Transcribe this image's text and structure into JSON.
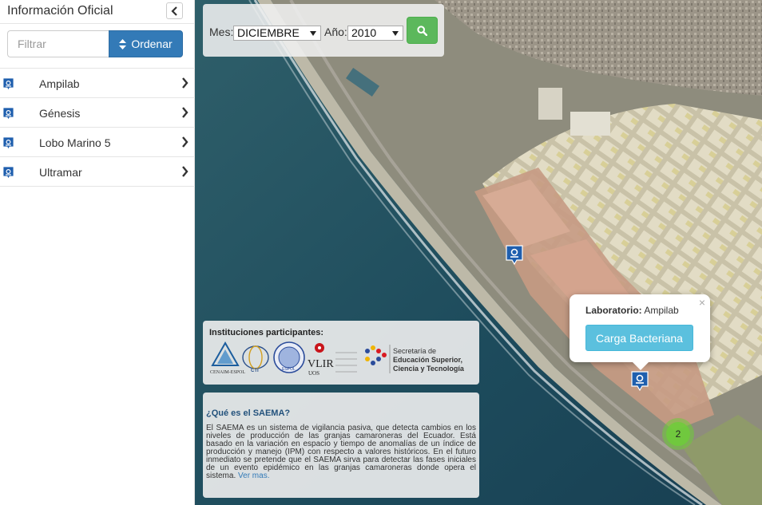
{
  "sidebar": {
    "title": "Información Oficial",
    "filter_placeholder": "Filtrar",
    "sort_label": "Ordenar",
    "items": [
      {
        "label": "Ampilab"
      },
      {
        "label": "Génesis"
      },
      {
        "label": "Lobo Marino 5"
      },
      {
        "label": "Ultramar"
      }
    ]
  },
  "filters": {
    "month_label": "Mes:",
    "month_value": "DICIEMBRE",
    "year_label": "Año:",
    "year_value": "2010"
  },
  "institutions": {
    "title": "Instituciones participantes:",
    "logos": {
      "cenaim": "CENAIM-ESPOL",
      "ctl": "CTI",
      "espol": "ESPOL",
      "vlir": "VLIR",
      "uos": "UOS",
      "senescyt_1": "Secretaría de",
      "senescyt_2": "Educación Superior,",
      "senescyt_3": "Ciencia y Tecnología"
    }
  },
  "about": {
    "title": "¿Qué es el SAEMA?",
    "text": "El SAEMA es un sistema de vigilancia pasiva, que detecta cambios en los niveles de producción de las granjas camaroneras del Ecuador. Está basado en la variación en espacio y tiempo de anomalías de un índice de producción y manejo (IPM) con respecto a valores históricos. En el futuro inmediato se pretende que el SAEMA sirva para detectar las fases iniciales de un evento epidémico en las granjas camaroneras donde opera el sistema.",
    "link": "Ver mas."
  },
  "popup": {
    "lab_label": "Laboratorio:",
    "lab_value": "Ampilab",
    "button": "Carga Bacteriana",
    "close": "×"
  },
  "cluster": {
    "count": "2"
  },
  "colors": {
    "primary": "#337ab7",
    "success": "#5cb85c",
    "info": "#5bc0de",
    "cluster": "#6ecc39",
    "marker": "#1f5fae"
  }
}
